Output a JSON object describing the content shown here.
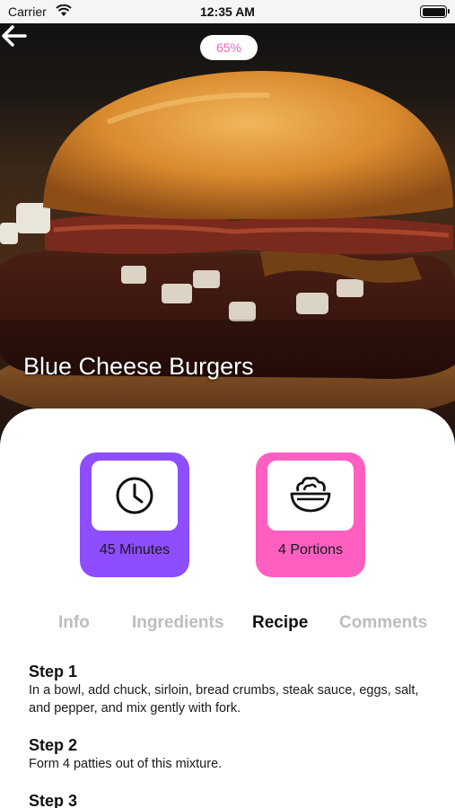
{
  "status_bar": {
    "carrier": "Carrier",
    "time": "12:35 AM"
  },
  "header": {
    "progress": "65%",
    "title": "Blue Cheese Burgers"
  },
  "stats": {
    "time_label": "45 Minutes",
    "portions_label": "4 Portions",
    "time_color": "#8e4dff",
    "portions_color": "#ff5fc1"
  },
  "tabs": [
    {
      "label": "Info",
      "active": false
    },
    {
      "label": "Ingredients",
      "active": false
    },
    {
      "label": "Recipe",
      "active": true
    },
    {
      "label": "Comments",
      "active": false
    }
  ],
  "steps": [
    {
      "title": "Step 1",
      "text": "In a bowl, add chuck, sirloin, bread crumbs, steak sauce, eggs, salt, and pepper, and mix gently with fork."
    },
    {
      "title": "Step 2",
      "text": "Form 4 patties out of this mixture."
    },
    {
      "title": "Step 3",
      "text": ""
    }
  ],
  "icons": [
    "back-arrow-icon",
    "wifi-icon",
    "battery-icon",
    "clock-icon",
    "salad-bowl-icon"
  ]
}
